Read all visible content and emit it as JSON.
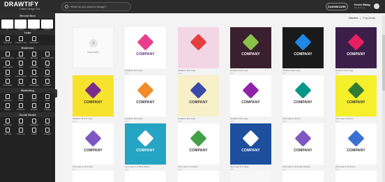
{
  "brand": {
    "name": "DRAWTIFY",
    "tagline": "Online Design Tool"
  },
  "search": {
    "placeholder": "What do you want to design?"
  },
  "header": {
    "dashboard_label": "DASHBOARD",
    "user_name": "Kevin Wang",
    "user_role": "My Account"
  },
  "sidebar": {
    "recent_title": "Recent files",
    "recent": [
      "V5",
      "Untitled",
      "Untitled",
      "Untitled"
    ],
    "logo_title": "Logo",
    "logo_items": [
      "Text Logo",
      "Graphic Logo",
      "Monogram"
    ],
    "business_title": "Business",
    "business_items": [
      "Business Card",
      "Certificate",
      "Resume",
      "Greeting Card",
      "Letter Head",
      "Flyer",
      "Postcard",
      "Label",
      "Report",
      "Letter Paper",
      "Envelope",
      "Product",
      "Newsletter",
      "ID Card",
      "Infographic",
      "Invitation"
    ],
    "marketing_title": "Marketing",
    "marketing_items": [
      "Gift Card",
      "Poster",
      "Menu",
      "Flyer",
      "Banner",
      "Brochure",
      "Booklet",
      "Catalog"
    ],
    "social_title": "Social Media",
    "social_items": [
      "Facebook",
      "Twitter",
      "Instagram",
      "Tumblr",
      "YouTube",
      "Pinterest",
      "Twitch",
      "LinkedIn"
    ]
  },
  "sort": {
    "newest": "Newest",
    "popularity": "Popularity",
    "separator": "|"
  },
  "blank": {
    "label": "New blank"
  },
  "cards": [
    {
      "title": "Gradient Text Logo",
      "price": "Free",
      "bg": "#ffffff",
      "accent": "#e83e8c",
      "text": "COMPANY",
      "textColor": "#5a2d82"
    },
    {
      "title": "Gradient Text Logo",
      "price": "Free",
      "bg": "#f3d6e4",
      "accent": "#e53e3e",
      "text": "",
      "textColor": "#333"
    },
    {
      "title": "Gradient Text Logo",
      "price": "Free",
      "bg": "#3a1f2e",
      "accent": "#8bc34a",
      "text": "COMPANY",
      "textColor": "#ffffff"
    },
    {
      "title": "Gradient Text Logo",
      "price": "Free",
      "bg": "#1a1a1a",
      "accent": "#1e88e5",
      "text": "COMPANY",
      "textColor": "#ffffff"
    },
    {
      "title": "Gradient Text Logo",
      "price": "Free",
      "bg": "#3b1f4a",
      "accent": "#e91e63",
      "text": "COMPANY",
      "textColor": "#ffffff"
    },
    {
      "title": "Gradient Text M Logo",
      "price": "Free",
      "bg": "#f7e22e",
      "accent": "#7b2d8e",
      "text": "COMPANY",
      "textColor": "#333"
    },
    {
      "title": "Gradient Text Logo",
      "price": "Free",
      "bg": "#ffffff",
      "accent": "#f28c28",
      "text": "COMPANY",
      "textColor": "#333"
    },
    {
      "title": "Gradient Text Logo",
      "price": "Free",
      "bg": "#f7f0c9",
      "accent": "#3949ab",
      "text": "COMPANY",
      "textColor": "#333"
    },
    {
      "title": "Gradient Text Logo",
      "price": "Free",
      "bg": "#ffffff",
      "accent": "#8e24aa",
      "text": "COMPANY",
      "textColor": "#333"
    },
    {
      "title": "Text Logo In Green",
      "price": "Free",
      "bg": "#ffffff",
      "accent": "#009688",
      "text": "COMPANY",
      "textColor": "#333"
    },
    {
      "title": "Text Logo In Green",
      "price": "Free",
      "bg": "#f5ef2c",
      "accent": "#2e7d32",
      "text": "COMPANY",
      "textColor": "#333"
    },
    {
      "title": "Text Logo In R Purple",
      "price": "Free",
      "bg": "#ffffff",
      "accent": "#7e57c2",
      "text": "COMPANY",
      "textColor": "#333"
    },
    {
      "title": "Text Logo In G Blue Green",
      "price": "Free",
      "bg": "#26a4c4",
      "accent": "#ffffff",
      "text": "COMPANY",
      "textColor": "#ffffff"
    },
    {
      "title": "Text Logo In G Green",
      "price": "Free",
      "bg": "#ffffff",
      "accent": "#43a047",
      "text": "COMPANY",
      "textColor": "#333"
    },
    {
      "title": "Text Logo In G Blue",
      "price": "Free",
      "bg": "#1e4f9c",
      "accent": "#ffffff",
      "text": "COMPANY",
      "textColor": "#ffffff"
    },
    {
      "title": "Text Logo In R Purple Orange",
      "price": "Free",
      "bg": "#ffffff",
      "accent": "#7e57c2",
      "text": "COMPANY",
      "textColor": "#333"
    },
    {
      "title": "Text Logo In R Green",
      "price": "Free",
      "bg": "#ffffff",
      "accent": "#3b6fd4",
      "text": "COMPANY",
      "textColor": "#333"
    }
  ]
}
